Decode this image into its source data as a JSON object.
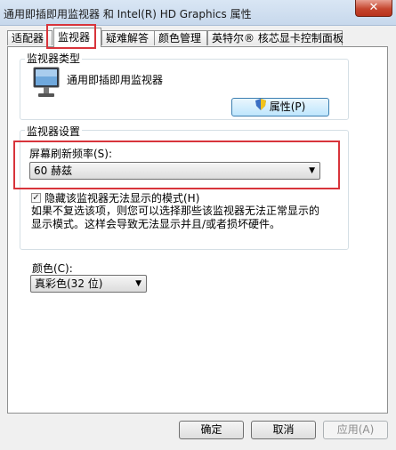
{
  "window": {
    "title": "通用即插即用监视器 和 Intel(R) HD Graphics 属性",
    "close_label": "✕"
  },
  "tabs": [
    {
      "label": "适配器"
    },
    {
      "label": "监视器"
    },
    {
      "label": "疑难解答"
    },
    {
      "label": "颜色管理"
    },
    {
      "label": "英特尔® 核芯显卡控制面板"
    }
  ],
  "monitor_type": {
    "group_label": "监视器类型",
    "name": "通用即插即用监视器",
    "properties_label": "属性(P)"
  },
  "monitor_settings": {
    "group_label": "监视器设置",
    "refresh_label": "屏幕刷新频率(S):",
    "refresh_value": "60 赫兹",
    "hide_modes_label": "隐藏该监视器无法显示的模式(H)",
    "hide_modes_checked": true,
    "description": "如果不复选该项，则您可以选择那些该监视器无法正常显示的显示模式。这样会导致无法显示并且/或者损坏硬件。"
  },
  "color": {
    "label": "颜色(C):",
    "value": "真彩色(32 位)"
  },
  "footer": {
    "ok_label": "确定",
    "cancel_label": "取消",
    "apply_label": "应用(A)"
  }
}
